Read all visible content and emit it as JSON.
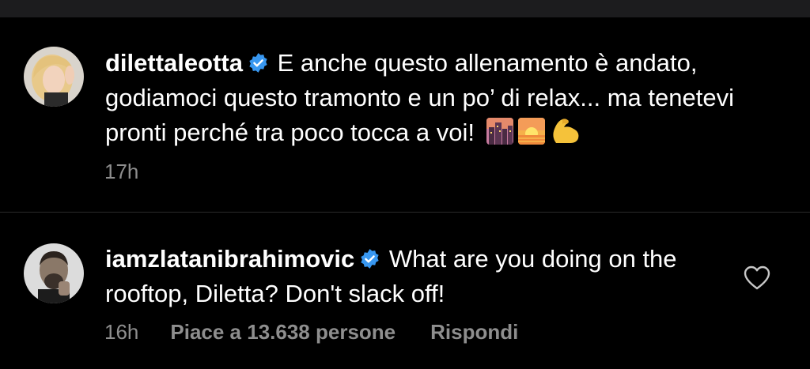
{
  "comments": [
    {
      "username": "dilettaleotta",
      "text": "E anche questo allenamento è andato, godiamoci questo tramonto e un po’ di relax... ma tenetevi pronti perché tra poco tocca a voi!",
      "emojis": [
        "cityscape-at-dusk",
        "sunrise",
        "flexed-biceps"
      ],
      "time": "17h"
    },
    {
      "username": "iamzlatanibrahimovic",
      "text": "What are you doing on the rooftop, Diletta? Don't slack off!",
      "time": "16h",
      "likes": "Piace a 13.638 persone",
      "reply": "Rispondi"
    }
  ],
  "colors": {
    "background": "#000000",
    "topbar": "#1c1c1e",
    "text": "#ffffff",
    "meta": "#8e8e8e",
    "verified": "#3897f0"
  }
}
